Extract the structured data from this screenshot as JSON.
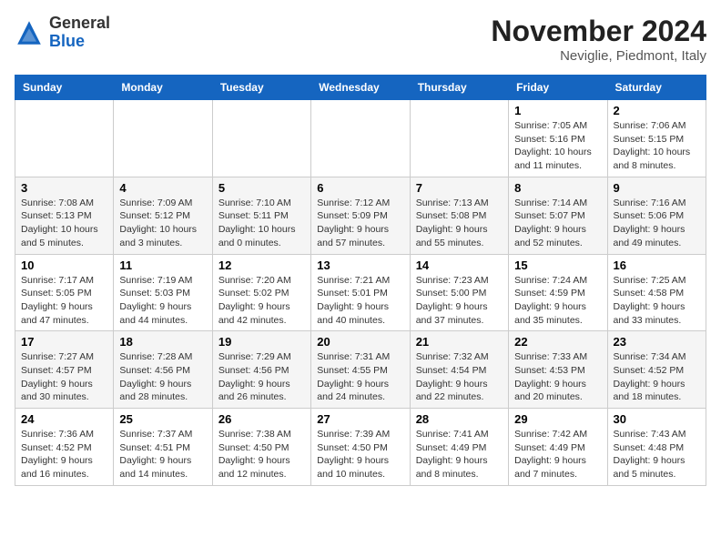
{
  "logo": {
    "general": "General",
    "blue": "Blue"
  },
  "header": {
    "month": "November 2024",
    "location": "Neviglie, Piedmont, Italy"
  },
  "weekdays": [
    "Sunday",
    "Monday",
    "Tuesday",
    "Wednesday",
    "Thursday",
    "Friday",
    "Saturday"
  ],
  "weeks": [
    [
      {
        "day": "",
        "info": ""
      },
      {
        "day": "",
        "info": ""
      },
      {
        "day": "",
        "info": ""
      },
      {
        "day": "",
        "info": ""
      },
      {
        "day": "",
        "info": ""
      },
      {
        "day": "1",
        "info": "Sunrise: 7:05 AM\nSunset: 5:16 PM\nDaylight: 10 hours and 11 minutes."
      },
      {
        "day": "2",
        "info": "Sunrise: 7:06 AM\nSunset: 5:15 PM\nDaylight: 10 hours and 8 minutes."
      }
    ],
    [
      {
        "day": "3",
        "info": "Sunrise: 7:08 AM\nSunset: 5:13 PM\nDaylight: 10 hours and 5 minutes."
      },
      {
        "day": "4",
        "info": "Sunrise: 7:09 AM\nSunset: 5:12 PM\nDaylight: 10 hours and 3 minutes."
      },
      {
        "day": "5",
        "info": "Sunrise: 7:10 AM\nSunset: 5:11 PM\nDaylight: 10 hours and 0 minutes."
      },
      {
        "day": "6",
        "info": "Sunrise: 7:12 AM\nSunset: 5:09 PM\nDaylight: 9 hours and 57 minutes."
      },
      {
        "day": "7",
        "info": "Sunrise: 7:13 AM\nSunset: 5:08 PM\nDaylight: 9 hours and 55 minutes."
      },
      {
        "day": "8",
        "info": "Sunrise: 7:14 AM\nSunset: 5:07 PM\nDaylight: 9 hours and 52 minutes."
      },
      {
        "day": "9",
        "info": "Sunrise: 7:16 AM\nSunset: 5:06 PM\nDaylight: 9 hours and 49 minutes."
      }
    ],
    [
      {
        "day": "10",
        "info": "Sunrise: 7:17 AM\nSunset: 5:05 PM\nDaylight: 9 hours and 47 minutes."
      },
      {
        "day": "11",
        "info": "Sunrise: 7:19 AM\nSunset: 5:03 PM\nDaylight: 9 hours and 44 minutes."
      },
      {
        "day": "12",
        "info": "Sunrise: 7:20 AM\nSunset: 5:02 PM\nDaylight: 9 hours and 42 minutes."
      },
      {
        "day": "13",
        "info": "Sunrise: 7:21 AM\nSunset: 5:01 PM\nDaylight: 9 hours and 40 minutes."
      },
      {
        "day": "14",
        "info": "Sunrise: 7:23 AM\nSunset: 5:00 PM\nDaylight: 9 hours and 37 minutes."
      },
      {
        "day": "15",
        "info": "Sunrise: 7:24 AM\nSunset: 4:59 PM\nDaylight: 9 hours and 35 minutes."
      },
      {
        "day": "16",
        "info": "Sunrise: 7:25 AM\nSunset: 4:58 PM\nDaylight: 9 hours and 33 minutes."
      }
    ],
    [
      {
        "day": "17",
        "info": "Sunrise: 7:27 AM\nSunset: 4:57 PM\nDaylight: 9 hours and 30 minutes."
      },
      {
        "day": "18",
        "info": "Sunrise: 7:28 AM\nSunset: 4:56 PM\nDaylight: 9 hours and 28 minutes."
      },
      {
        "day": "19",
        "info": "Sunrise: 7:29 AM\nSunset: 4:56 PM\nDaylight: 9 hours and 26 minutes."
      },
      {
        "day": "20",
        "info": "Sunrise: 7:31 AM\nSunset: 4:55 PM\nDaylight: 9 hours and 24 minutes."
      },
      {
        "day": "21",
        "info": "Sunrise: 7:32 AM\nSunset: 4:54 PM\nDaylight: 9 hours and 22 minutes."
      },
      {
        "day": "22",
        "info": "Sunrise: 7:33 AM\nSunset: 4:53 PM\nDaylight: 9 hours and 20 minutes."
      },
      {
        "day": "23",
        "info": "Sunrise: 7:34 AM\nSunset: 4:52 PM\nDaylight: 9 hours and 18 minutes."
      }
    ],
    [
      {
        "day": "24",
        "info": "Sunrise: 7:36 AM\nSunset: 4:52 PM\nDaylight: 9 hours and 16 minutes."
      },
      {
        "day": "25",
        "info": "Sunrise: 7:37 AM\nSunset: 4:51 PM\nDaylight: 9 hours and 14 minutes."
      },
      {
        "day": "26",
        "info": "Sunrise: 7:38 AM\nSunset: 4:50 PM\nDaylight: 9 hours and 12 minutes."
      },
      {
        "day": "27",
        "info": "Sunrise: 7:39 AM\nSunset: 4:50 PM\nDaylight: 9 hours and 10 minutes."
      },
      {
        "day": "28",
        "info": "Sunrise: 7:41 AM\nSunset: 4:49 PM\nDaylight: 9 hours and 8 minutes."
      },
      {
        "day": "29",
        "info": "Sunrise: 7:42 AM\nSunset: 4:49 PM\nDaylight: 9 hours and 7 minutes."
      },
      {
        "day": "30",
        "info": "Sunrise: 7:43 AM\nSunset: 4:48 PM\nDaylight: 9 hours and 5 minutes."
      }
    ]
  ]
}
